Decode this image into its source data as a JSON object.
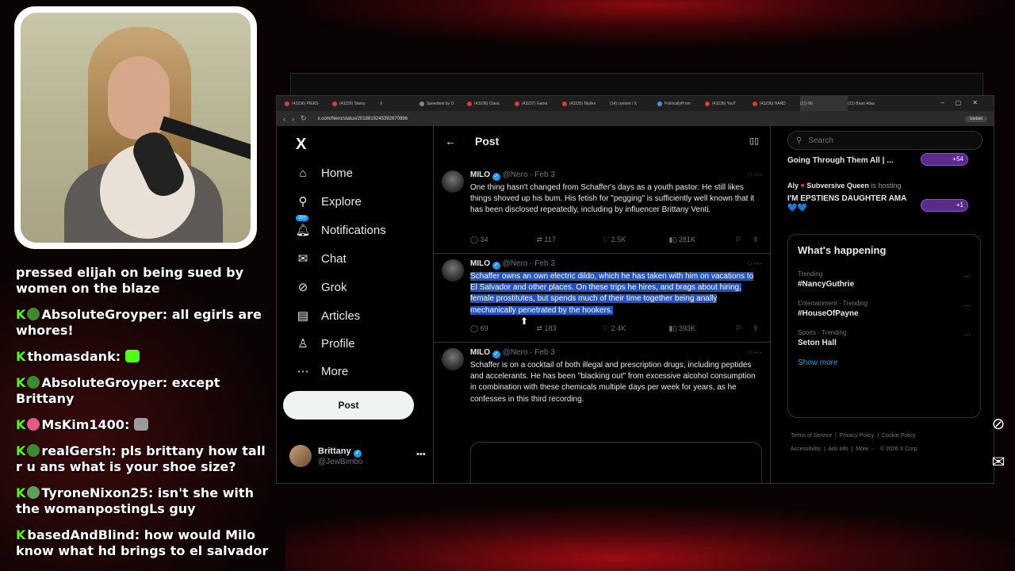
{
  "chat": [
    {
      "user": "",
      "message": "pressed elijah on being sued by women on the blaze",
      "badge_color": ""
    },
    {
      "user": "AbsoluteGroyper",
      "message": "all egirls are whores!",
      "badge_color": "#3b8a2e"
    },
    {
      "user": "thomasdank",
      "message": "",
      "badge_color": "",
      "emote_color": "#53fc18"
    },
    {
      "user": "AbsoluteGroyper",
      "message": "except Brittany",
      "badge_color": "#3b8a2e"
    },
    {
      "user": "MsKim1400",
      "message": "",
      "badge_color": "#e05a8a",
      "emote_color": "#9a9aa0"
    },
    {
      "user": "realGersh",
      "message": "pls brittany how tall r u ans what is your shoe size?",
      "badge_color": "#3b8a2e"
    },
    {
      "user": "TyroneNixon25",
      "message": "isn't she with the womanpostingLs guy",
      "badge_color": "#5aa05a"
    },
    {
      "user": "basedAndBlind",
      "message": "how would Milo know what hd brings to el salvador",
      "badge_color": ""
    }
  ],
  "browser": {
    "tabs": [
      "(43236) PIERS",
      "(43235) Steiny",
      "X",
      "Speedtest by O",
      "(43236) Clavic",
      "(43237) Game",
      "(43235) Mullen",
      "(14) content / X",
      "PoliticallyProm",
      "(43236) YouT",
      "(43236) HARD",
      "(21) Mi",
      "(21) Brian Atlas"
    ],
    "url": "x.com/Nero/status/2018819245392670896",
    "update_label": "Update"
  },
  "nav": {
    "logo": "X",
    "items": [
      {
        "label": "Home",
        "icon": "home-icon",
        "glyph": "⌂"
      },
      {
        "label": "Explore",
        "icon": "search-icon",
        "glyph": "⚲"
      },
      {
        "label": "Notifications",
        "icon": "bell-icon",
        "glyph": "🔔︎",
        "badge": "20+"
      },
      {
        "label": "Chat",
        "icon": "mail-icon",
        "glyph": "✉"
      },
      {
        "label": "Grok",
        "icon": "grok-icon",
        "glyph": "⊘"
      },
      {
        "label": "Articles",
        "icon": "articles-icon",
        "glyph": "▤"
      },
      {
        "label": "Profile",
        "icon": "person-icon",
        "glyph": "♙"
      },
      {
        "label": "More",
        "icon": "more-circle-icon",
        "glyph": "⋯"
      }
    ],
    "post_label": "Post",
    "profile_name": "Brittany",
    "profile_handle": "@JewBimbo"
  },
  "main": {
    "header_title": "Post",
    "tweets": [
      {
        "name": "MILO",
        "handle": "@Nero",
        "date": "Feb 3",
        "text": "One thing hasn't changed from Schaffer's days as a youth pastor: He still likes things shoved up his bum. His fetish for \"pegging\" is sufficiently well known that it has been disclosed repeatedly, including by influencer Brittany Venti.",
        "replies": "34",
        "reposts": "117",
        "likes": "2.5K",
        "views": "281K"
      },
      {
        "name": "MILO",
        "handle": "@Nero",
        "date": "Feb 3",
        "text": "Schaffer owns an own electric dildo, which he has taken with him on vacations to El Salvador and other places. On these trips he hires, and brags about hiring, female prostitutes, but spends much of their time together being anally mechanically penetrated by the hookers.",
        "replies": "69",
        "reposts": "183",
        "likes": "2.4K",
        "views": "393K"
      },
      {
        "name": "MILO",
        "handle": "@Nero",
        "date": "Feb 3",
        "text": "Schaffer is on a cocktail of both illegal and prescription drugs, including peptides and accelerants. He has been \"blacking out\" from excessive alcohol consumption in combination with these chemicals multiple days per week for years, as he confesses in this third recording.",
        "replies": "",
        "reposts": "",
        "likes": "",
        "views": ""
      }
    ]
  },
  "right": {
    "search_placeholder": "Search",
    "live1_title": "Going Through Them All | ...",
    "live1_count": "+54",
    "live2_host_user": "Aly",
    "live2_host_name": "Subversive Queen",
    "live2_host_suffix": "is hosting",
    "live2_title": "I'M EPSTIENS DAUGHTER AMA 💙💙",
    "live2_count": "+1",
    "happening_title": "What's happening",
    "trends": [
      {
        "meta": "Trending",
        "topic": "#NancyGuthrie"
      },
      {
        "meta": "Entertainment · Trending",
        "topic": "#HouseOfPayne"
      },
      {
        "meta": "Sports · Trending",
        "topic": "Seton Hall"
      }
    ],
    "show_more": "Show more",
    "footer": [
      "Terms of Service",
      "Privacy Policy",
      "Cookie Policy",
      "Accessibility",
      "Ads info",
      "More ···",
      "© 2026 X Corp."
    ]
  },
  "colors": {
    "accent": "#1d9bf0",
    "highlight": "#2253c4",
    "kick_green": "#53fc18"
  }
}
